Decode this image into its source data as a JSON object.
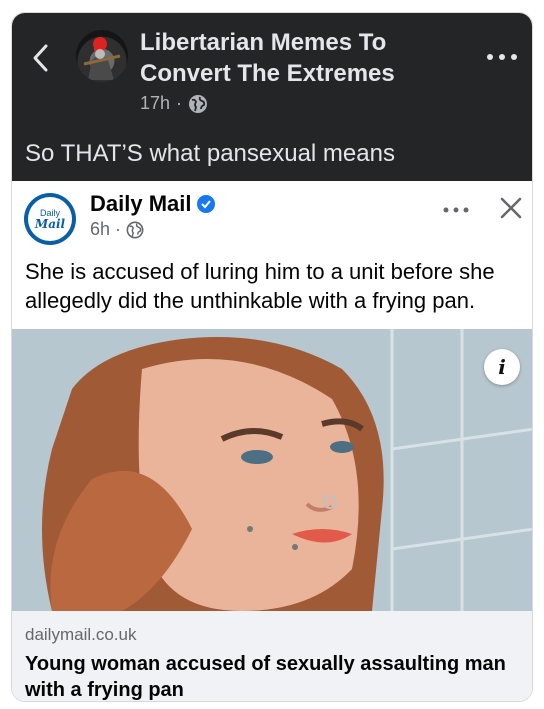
{
  "group": {
    "name": "Libertarian Memes To Convert The Extremes",
    "time": "17h",
    "separator": "·",
    "audience_icon": "globe-icon"
  },
  "post": {
    "caption": "So THAT’S what pansexual means"
  },
  "shared": {
    "publisher": "Daily Mail",
    "logo_line1": "Daily",
    "logo_line2": "Mail",
    "time": "6h",
    "separator": "·",
    "verified_icon": "verified-badge-icon",
    "text": "She is accused of luring him to a unit before she allegedly did the unthinkable with a frying pan.",
    "info_label": "i",
    "link": {
      "domain": "dailymail.co.uk",
      "headline": "Young woman accused of sexually assaulting man with a frying pan"
    }
  },
  "colors": {
    "header_bg": "#242526",
    "header_text": "#e4e6eb",
    "muted_dark": "#b0b3b8",
    "link_bg": "#f0f2f5",
    "dailymail_blue": "#0a5ea8",
    "verified_blue": "#1877f2"
  }
}
